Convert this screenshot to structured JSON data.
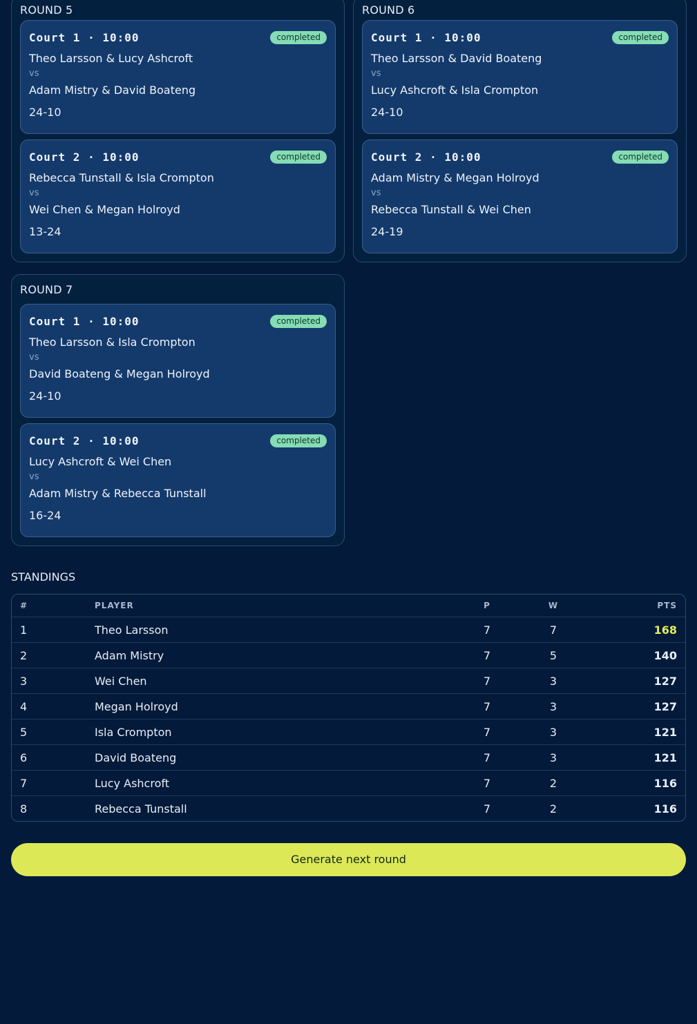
{
  "rounds": [
    {
      "title": "ROUND 5",
      "matches": [
        {
          "court": "Court 1 · 10:00",
          "status": "completed",
          "team1": "Theo Larsson & Lucy Ashcroft",
          "vs": "vs",
          "team2": "Adam Mistry & David Boateng",
          "score": "24-10"
        },
        {
          "court": "Court 2 · 10:00",
          "status": "completed",
          "team1": "Rebecca Tunstall & Isla Crompton",
          "vs": "vs",
          "team2": "Wei Chen & Megan Holroyd",
          "score": "13-24"
        }
      ]
    },
    {
      "title": "ROUND 6",
      "matches": [
        {
          "court": "Court 1 · 10:00",
          "status": "completed",
          "team1": "Theo Larsson & David Boateng",
          "vs": "vs",
          "team2": "Lucy Ashcroft & Isla Crompton",
          "score": "24-10"
        },
        {
          "court": "Court 2 · 10:00",
          "status": "completed",
          "team1": "Adam Mistry & Megan Holroyd",
          "vs": "vs",
          "team2": "Rebecca Tunstall & Wei Chen",
          "score": "24-19"
        }
      ]
    },
    {
      "title": "ROUND 7",
      "matches": [
        {
          "court": "Court 1 · 10:00",
          "status": "completed",
          "team1": "Theo Larsson & Isla Crompton",
          "vs": "vs",
          "team2": "David Boateng & Megan Holroyd",
          "score": "24-10"
        },
        {
          "court": "Court 2 · 10:00",
          "status": "completed",
          "team1": "Lucy Ashcroft & Wei Chen",
          "vs": "vs",
          "team2": "Adam Mistry & Rebecca Tunstall",
          "score": "16-24"
        }
      ]
    }
  ],
  "standings": {
    "title": "STANDINGS",
    "headers": {
      "rank": "#",
      "player": "PLAYER",
      "played": "P",
      "wins": "W",
      "points": "PTS"
    },
    "rows": [
      {
        "rank": "1",
        "player": "Theo Larsson",
        "played": "7",
        "wins": "7",
        "points": "168"
      },
      {
        "rank": "2",
        "player": "Adam Mistry",
        "played": "7",
        "wins": "5",
        "points": "140"
      },
      {
        "rank": "3",
        "player": "Wei Chen",
        "played": "7",
        "wins": "3",
        "points": "127"
      },
      {
        "rank": "4",
        "player": "Megan Holroyd",
        "played": "7",
        "wins": "3",
        "points": "127"
      },
      {
        "rank": "5",
        "player": "Isla Crompton",
        "played": "7",
        "wins": "3",
        "points": "121"
      },
      {
        "rank": "6",
        "player": "David Boateng",
        "played": "7",
        "wins": "3",
        "points": "121"
      },
      {
        "rank": "7",
        "player": "Lucy Ashcroft",
        "played": "7",
        "wins": "2",
        "points": "116"
      },
      {
        "rank": "8",
        "player": "Rebecca Tunstall",
        "played": "7",
        "wins": "2",
        "points": "116"
      }
    ]
  },
  "actions": {
    "generate_label": "Generate next round"
  },
  "colors": {
    "background": "#031a3a",
    "card": "#143a6b",
    "badge": "#86dcb4",
    "accent": "#dde856",
    "leader_points": "#e3ee5a"
  }
}
